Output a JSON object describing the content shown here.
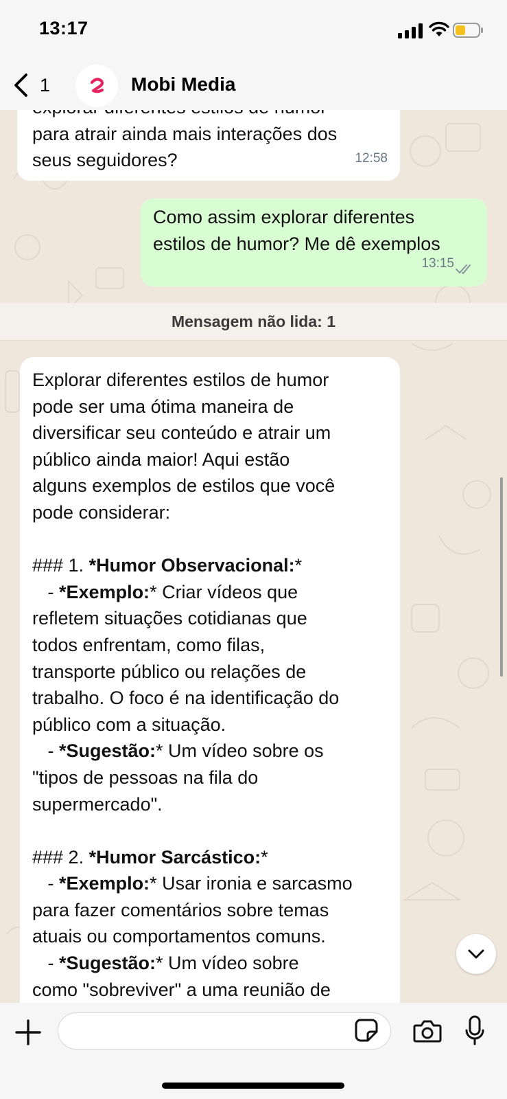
{
  "status_bar": {
    "time": "13:17"
  },
  "header": {
    "back_count": "1",
    "contact_name": "Mobi Media",
    "avatar_icon": "mobi-media-logo",
    "accent_color": "#e6245f"
  },
  "messages": [
    {
      "direction": "incoming",
      "text": "explorar diferentes estilos de humor\npara atrair ainda mais interações dos\nseus seguidores?",
      "time": "12:58"
    },
    {
      "direction": "outgoing",
      "text": "Como assim explorar diferentes\nestilos de humor? Me dê exemplos",
      "time": "13:15",
      "status_icon": "double-check-icon"
    }
  ],
  "unread_divider": {
    "label": "Mensagem não lida: 1"
  },
  "long_message": {
    "intro": "Explorar diferentes estilos de humor\npode ser uma ótima maneira de\ndiversificar seu conteúdo e atrair um\npúblico ainda maior! Aqui estão\nalguns exemplos de estilos que você\npode considerar:",
    "section1": {
      "heading_prefix": "### 1. ",
      "heading_bold": "*Humor Observacional:",
      "heading_suffix": "*",
      "exemplo_prefix": "   - ",
      "exemplo_bold": "*Exemplo:",
      "exemplo_text": "* Criar vídeos que\nrefletem situações cotidianas que\ntodos enfrentam, como filas,\ntransporte público ou relações de\ntrabalho. O foco é na identificação do\npúblico com a situação.",
      "sugestao_prefix": "   - ",
      "sugestao_bold": "*Sugestão:",
      "sugestao_text": "* Um vídeo sobre os\n\"tipos de pessoas na fila do\nsupermercado\"."
    },
    "section2": {
      "heading_prefix": "### 2. ",
      "heading_bold": "*Humor Sarcástico:",
      "heading_suffix": "*",
      "exemplo_prefix": "   - ",
      "exemplo_bold": "*Exemplo:",
      "exemplo_text": "* Usar ironia e sarcasmo\npara fazer comentários sobre temas\natuais ou comportamentos comuns.",
      "sugestao_prefix": "   - ",
      "sugestao_bold": "*Sugestão:",
      "sugestao_text": "* Um vídeo sobre\ncomo \"sobreviver\" a uma reunião de"
    }
  },
  "composer": {
    "input_value": "",
    "icons": [
      "plus-icon",
      "sticker-icon",
      "camera-icon",
      "microphone-icon"
    ]
  },
  "colors": {
    "outgoing_bubble": "#d9fdd3",
    "incoming_bubble": "#ffffff",
    "chat_background": "#efe7dc",
    "read_receipt": "#667781"
  }
}
